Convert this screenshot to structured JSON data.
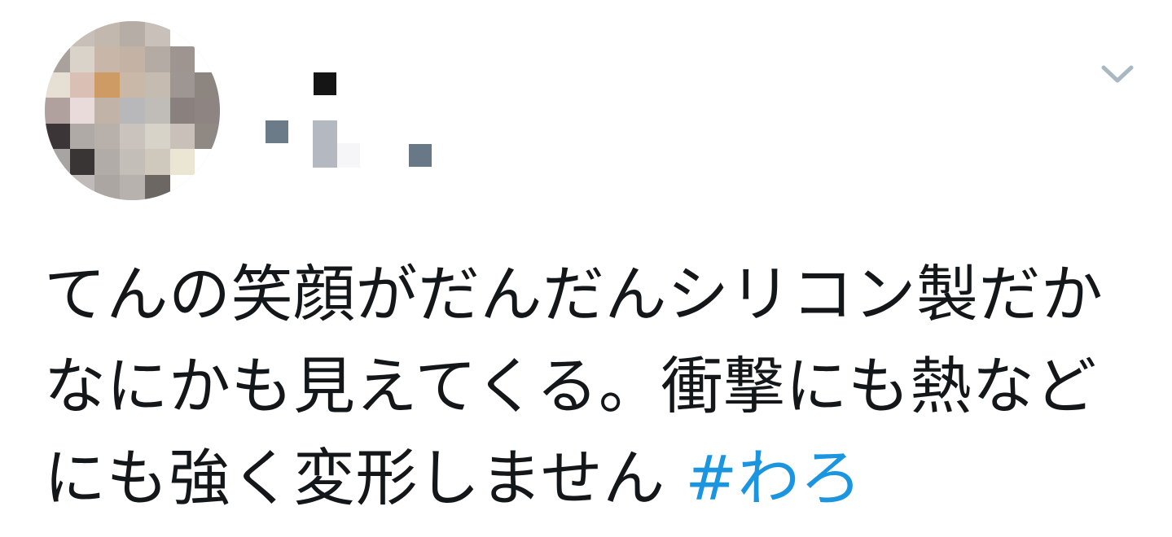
{
  "tweet": {
    "text": "てんの笑顔がだんだんシリコン製だかなにかも見えてくる。衝撃にも熱などにも強く変形しません ",
    "hashtag": "#わろ"
  },
  "colors": {
    "text": "#14171a",
    "link": "#1b95e0",
    "caret": "#aab8c2",
    "background": "#ffffff"
  },
  "icons": {
    "caret": "chevron-down-icon"
  }
}
